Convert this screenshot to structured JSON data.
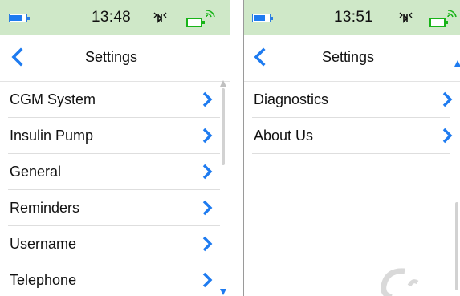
{
  "screens": [
    {
      "status": {
        "time": "13:48"
      },
      "header": {
        "title": "Settings"
      },
      "menu": [
        {
          "label": "CGM System"
        },
        {
          "label": "Insulin Pump"
        },
        {
          "label": "General"
        },
        {
          "label": "Reminders"
        },
        {
          "label": "Username"
        },
        {
          "label": "Telephone"
        }
      ]
    },
    {
      "status": {
        "time": "13:51"
      },
      "header": {
        "title": "Settings"
      },
      "menu": [
        {
          "label": "Diagnostics"
        },
        {
          "label": "About Us"
        }
      ]
    }
  ],
  "icons": {
    "battery": "battery-icon",
    "bluetooth": "bluetooth-icon",
    "pump": "pump-battery-icon",
    "signal": "signal-icon",
    "back": "back-chevron-icon",
    "chevron": "chevron-right-icon"
  },
  "colors": {
    "status_bar": "#cfe8c8",
    "accent_blue": "#1e7bf0",
    "pump_green": "#18b418"
  }
}
